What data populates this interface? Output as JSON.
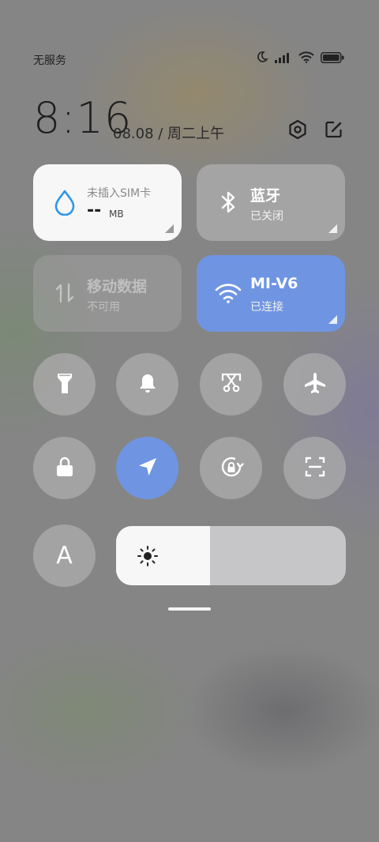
{
  "status_bar": {
    "carrier": "无服务",
    "icons": [
      "moon-icon",
      "signal-icon",
      "wifi-icon",
      "battery-icon"
    ]
  },
  "header": {
    "time": "8:16",
    "date": "08.08 / 周二上午",
    "icons": [
      "settings-icon",
      "edit-icon"
    ]
  },
  "tiles": {
    "data": {
      "title": "未插入SIM卡",
      "value": "--",
      "unit": "MB",
      "active": true,
      "icon": "water-drop-icon"
    },
    "bluetooth": {
      "title": "蓝牙",
      "status": "已关闭",
      "active": false,
      "icon": "bluetooth-icon"
    },
    "mobile_data": {
      "title": "移动数据",
      "status": "不可用",
      "active": false,
      "disabled": true,
      "icon": "data-arrows-icon"
    },
    "wifi": {
      "title": "MI-V6",
      "status": "已连接",
      "active": true,
      "icon": "wifi-icon"
    }
  },
  "toggles": [
    {
      "name": "flashlight",
      "icon": "flashlight-icon",
      "active": false
    },
    {
      "name": "ringer",
      "icon": "bell-icon",
      "active": false
    },
    {
      "name": "screenshot",
      "icon": "screenshot-icon",
      "active": false
    },
    {
      "name": "airplane-mode",
      "icon": "airplane-icon",
      "active": false
    },
    {
      "name": "lock-screen",
      "icon": "lock-icon",
      "active": false
    },
    {
      "name": "location",
      "icon": "location-arrow-icon",
      "active": true
    },
    {
      "name": "rotation-lock",
      "icon": "rotation-lock-icon",
      "active": false
    },
    {
      "name": "scanner",
      "icon": "scan-icon",
      "active": false
    },
    {
      "name": "auto-brightness",
      "icon": "auto-brightness-icon",
      "label": "A",
      "active": false
    }
  ],
  "brightness": {
    "level": 0.41,
    "icon": "sun-icon"
  },
  "colors": {
    "accent": "#6f95e2",
    "tile_light": "#f7f7f7",
    "tile_dim": "#a8a8a8",
    "data_icon": "#2f96e8"
  }
}
